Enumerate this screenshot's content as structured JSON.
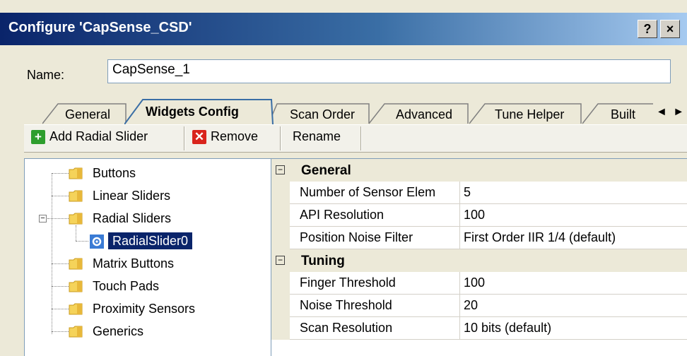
{
  "window": {
    "title": "Configure 'CapSense_CSD'",
    "help_label": "?",
    "close_label": "×"
  },
  "name_field": {
    "label": "Name:",
    "value": "CapSense_1"
  },
  "tabs": [
    {
      "label": "General",
      "active": false
    },
    {
      "label": "Widgets Config",
      "active": true
    },
    {
      "label": "Scan Order",
      "active": false
    },
    {
      "label": "Advanced",
      "active": false
    },
    {
      "label": "Tune Helper",
      "active": false
    },
    {
      "label": "Built",
      "active": false
    }
  ],
  "tab_scroll": {
    "left": "◄",
    "right": "►"
  },
  "toolbar": {
    "add_label": "Add Radial Slider",
    "remove_label": "Remove",
    "rename_label": "Rename"
  },
  "tree": {
    "items": [
      {
        "label": "Buttons"
      },
      {
        "label": "Linear Sliders"
      },
      {
        "label": "Radial Sliders",
        "expanded": true,
        "children": [
          {
            "label": "RadialSlider0",
            "selected": true
          }
        ]
      },
      {
        "label": "Matrix Buttons"
      },
      {
        "label": "Touch Pads"
      },
      {
        "label": "Proximity Sensors"
      },
      {
        "label": "Generics"
      }
    ]
  },
  "properties": {
    "categories": [
      {
        "name": "General",
        "rows": [
          {
            "name": "Number of Sensor Elem",
            "value": "5"
          },
          {
            "name": "API Resolution",
            "value": "100"
          },
          {
            "name": "Position Noise Filter",
            "value": "First Order IIR 1/4 (default)"
          }
        ]
      },
      {
        "name": "Tuning",
        "rows": [
          {
            "name": "Finger Threshold",
            "value": "100"
          },
          {
            "name": "Noise Threshold",
            "value": "20"
          },
          {
            "name": "Scan Resolution",
            "value": "10 bits (default)"
          }
        ]
      }
    ],
    "collapse_glyph": "⊟"
  },
  "colors": {
    "title_start": "#0a246a",
    "title_end": "#a6caf0",
    "selection": "#0a246a",
    "add_icon": "#2e9e2e",
    "remove_icon": "#d9241c"
  }
}
